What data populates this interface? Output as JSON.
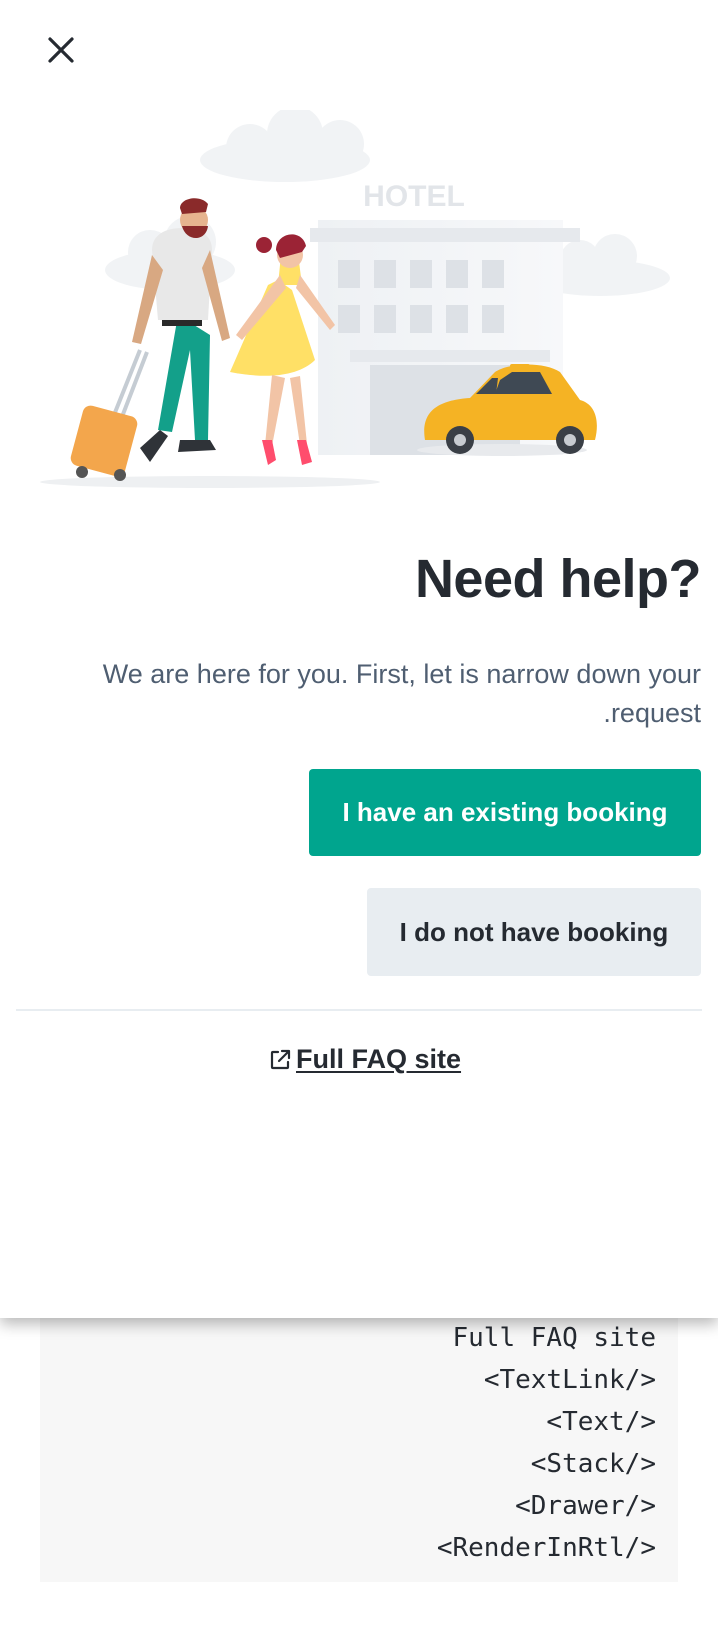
{
  "drawer": {
    "title": "?Need help",
    "description": "We are here for you. First, let is narrow down your request.",
    "primary_button": "I have an existing booking",
    "secondary_button": "I do not have booking",
    "faq_link": "Full FAQ site",
    "close_icon": "close-icon",
    "faq_icon": "external-link-icon"
  },
  "illustration": {
    "hotel_sign": "HOTEL"
  },
  "code_block": {
    "lines": [
      "Full FAQ site",
      "<TextLink/>",
      "<Text/>",
      "<Stack/>",
      "<Drawer/>",
      "<RenderInRtl/>"
    ]
  },
  "colors": {
    "primary": "#00a58e",
    "secondary_bg": "#e8edf1",
    "text_dark": "#252a31",
    "text_secondary": "#4f5e71",
    "code_bg": "#f7f7f7"
  }
}
